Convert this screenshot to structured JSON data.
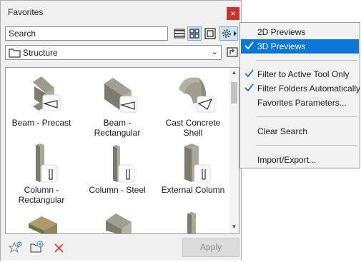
{
  "panel": {
    "title": "Favorites",
    "close_glyph": "×",
    "search": {
      "placeholder": "Search",
      "value": ""
    },
    "view_buttons": [
      {
        "icon": "list-view-icon",
        "selected": false
      },
      {
        "icon": "grid-view-icon",
        "selected": true
      },
      {
        "icon": "large-preview-icon",
        "selected": false
      },
      {
        "icon": "gear-icon",
        "selected": true
      }
    ],
    "folder": {
      "label": "Structure"
    },
    "items": [
      {
        "label": "Beam - Precast",
        "icon": "beam-precast-preview"
      },
      {
        "label": "Beam - Rectangular",
        "icon": "beam-rectangular-preview"
      },
      {
        "label": "Cast Concrete Shell",
        "icon": "shell-preview"
      },
      {
        "label": "Column - Rectangular",
        "icon": "column-rectangular-preview"
      },
      {
        "label": "Column - Steel",
        "icon": "column-steel-preview"
      },
      {
        "label": "External Column",
        "icon": "external-column-preview"
      }
    ],
    "bottom": {
      "apply_label": "Apply"
    }
  },
  "menu": {
    "items": [
      {
        "label": "2D Previews",
        "checked": false,
        "highlighted": false
      },
      {
        "label": "3D Previews",
        "checked": true,
        "highlighted": true
      },
      {
        "label": "Filter to Active Tool Only",
        "checked": true,
        "highlighted": false
      },
      {
        "label": "Filter Folders Automatically",
        "checked": true,
        "highlighted": false
      },
      {
        "label": "Favorites Parameters...",
        "checked": false,
        "highlighted": false
      },
      {
        "label": "Clear Search",
        "checked": false,
        "highlighted": false
      },
      {
        "label": "Import/Export...",
        "checked": false,
        "highlighted": false
      }
    ]
  },
  "colors": {
    "highlight": "#0b78d7",
    "close": "#c8332f",
    "check": "#1f6fc0",
    "delete": "#e0554a"
  }
}
